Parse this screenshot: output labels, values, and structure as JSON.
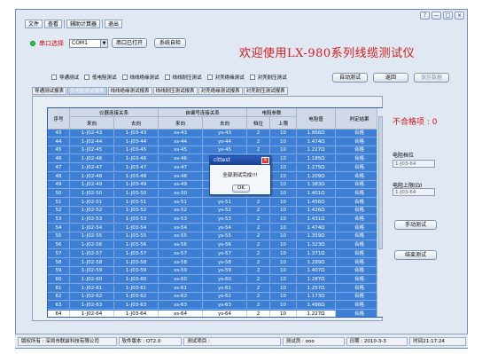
{
  "window_controls": [
    "?",
    "—",
    "□",
    "×"
  ],
  "menu": [
    "文件",
    "查看",
    "辅助计算器",
    "退出"
  ],
  "port": {
    "label": "串口选择",
    "value": "COM1",
    "open_label": "串口已打开",
    "self_check": "系统自检"
  },
  "title": "欢迎使用LX-980系列线缆测试仪",
  "modes": [
    "导通测试",
    "低电阻测试",
    "线线绝缘测试",
    "线线耐压测试",
    "对壳绝缘测试",
    "对壳耐压测试"
  ],
  "actions": {
    "auto_test": "自动测试",
    "back": "返回",
    "save_data": "保存数据"
  },
  "tabs": [
    "导通测试报表",
    "低电阻测试报表",
    "线线绝缘测试报表",
    "线线耐压测试报表",
    "对壳绝缘测试报表",
    "对壳耐压测试报表"
  ],
  "table": {
    "headers": {
      "seq": "序号",
      "instrument": "仪器连接关系",
      "harness": "自编号连接关系",
      "res_params": "电阻参数",
      "from": "来向",
      "to": "去向",
      "range": "档位",
      "upper": "上限",
      "res_value": "电阻值",
      "result": "判定结果"
    },
    "rows": [
      [
        "43",
        "1-J02-43",
        "1-J03-43",
        "xs-43",
        "ys-43",
        "2",
        "10",
        "1.866Ω",
        "合格"
      ],
      [
        "44",
        "1-J02-44",
        "1-J03-44",
        "xs-44",
        "ys-44",
        "2",
        "10",
        "1.474Ω",
        "合格"
      ],
      [
        "45",
        "1-J02-45",
        "1-J03-45",
        "xs-45",
        "ys-45",
        "2",
        "10",
        "1.227Ω",
        "合格"
      ],
      [
        "46",
        "1-J02-46",
        "1-J03-46",
        "xs-46",
        "ys-46",
        "2",
        "10",
        "1.185Ω",
        "合格"
      ],
      [
        "47",
        "1-J02-47",
        "1-J03-47",
        "xs-47",
        "ys-47",
        "2",
        "10",
        "1.275Ω",
        "合格"
      ],
      [
        "48",
        "1-J02-48",
        "1-J03-48",
        "xs-48",
        "ys-48",
        "2",
        "10",
        "1.209Ω",
        "合格"
      ],
      [
        "49",
        "1-J02-49",
        "1-J03-49",
        "xs-49",
        "ys-49",
        "2",
        "10",
        "1.383Ω",
        "合格"
      ],
      [
        "50",
        "1-J02-50",
        "1-J03-50",
        "xs-50",
        "ys-50",
        "2",
        "10",
        "1.401Ω",
        "合格"
      ],
      [
        "51",
        "1-J02-51",
        "1-J03-51",
        "xs-51",
        "ys-51",
        "2",
        "10",
        "1.456Ω",
        "合格"
      ],
      [
        "52",
        "1-J02-52",
        "1-J03-52",
        "xs-52",
        "ys-52",
        "2",
        "10",
        "1.426Ω",
        "合格"
      ],
      [
        "53",
        "1-J02-53",
        "1-J03-53",
        "xs-53",
        "ys-53",
        "2",
        "10",
        "1.431Ω",
        "合格"
      ],
      [
        "54",
        "1-J02-54",
        "1-J03-54",
        "xs-54",
        "ys-54",
        "2",
        "10",
        "1.474Ω",
        "合格"
      ],
      [
        "55",
        "1-J02-55",
        "1-J03-55",
        "xs-55",
        "ys-55",
        "2",
        "10",
        "1.359Ω",
        "合格"
      ],
      [
        "56",
        "1-J02-56",
        "1-J03-56",
        "xs-56",
        "ys-56",
        "2",
        "10",
        "1.323Ω",
        "合格"
      ],
      [
        "57",
        "1-J02-57",
        "1-J03-57",
        "xs-57",
        "ys-57",
        "2",
        "10",
        "1.371Ω",
        "合格"
      ],
      [
        "58",
        "1-J02-58",
        "1-J03-58",
        "xs-58",
        "ys-58",
        "2",
        "10",
        "1.299Ω",
        "合格"
      ],
      [
        "59",
        "1-J02-59",
        "1-J03-59",
        "xs-59",
        "ys-59",
        "2",
        "10",
        "1.407Ω",
        "合格"
      ],
      [
        "60",
        "1-J02-60",
        "1-J03-60",
        "xs-60",
        "ys-60",
        "2",
        "10",
        "1.287Ω",
        "合格"
      ],
      [
        "61",
        "1-J02-61",
        "1-J03-61",
        "xs-61",
        "ys-61",
        "2",
        "10",
        "1.257Ω",
        "合格"
      ],
      [
        "62",
        "1-J02-62",
        "1-J03-62",
        "xs-62",
        "ys-62",
        "2",
        "10",
        "1.173Ω",
        "合格"
      ],
      [
        "63",
        "1-J02-63",
        "1-J03-63",
        "xs-63",
        "ys-63",
        "2",
        "10",
        "1.486Ω",
        "合格"
      ],
      [
        "64",
        "1-J02-64",
        "1-J03-64",
        "xs-64",
        "ys-64",
        "2",
        "10",
        "1.227Ω",
        "合格"
      ]
    ]
  },
  "side": {
    "fail_label": "不合格项 : 0",
    "range_label": "电阻档位",
    "range_value": "1-J03-64",
    "upper_label": "电阻上限(Ω)",
    "upper_value": "1-J03-64",
    "manual_test": "手动测试",
    "end_test": "结束测试"
  },
  "status": {
    "copyright": "版权所有 : 深圳市联兹科技有限公司",
    "software": "软件版本 : OT2.0",
    "project": "测试项目 :",
    "tester": "测试员 : ooo",
    "date": "日期 : 2010-3-3",
    "time": "时间21:17:24"
  },
  "dialog": {
    "title": "cittest",
    "message": "全部测试完成!!!",
    "ok": "OK"
  },
  "colors": {
    "grid_bg": "#3e7fd6",
    "title": "#d51a1a",
    "dialog_title": "#1b3f8e"
  }
}
